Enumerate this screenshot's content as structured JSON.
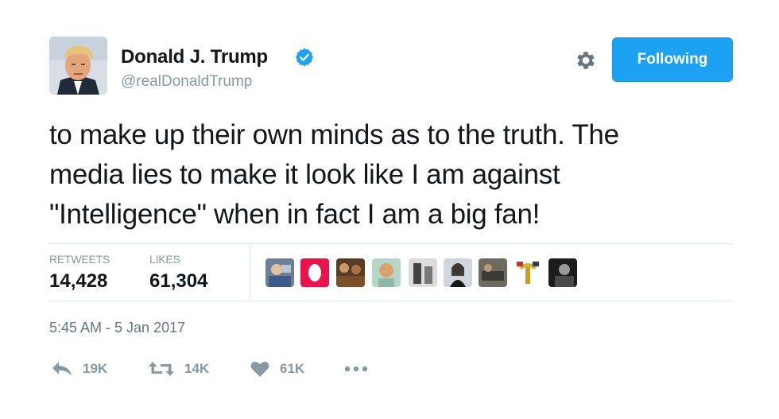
{
  "user": {
    "name": "Donald J. Trump",
    "handle": "@realDonaldTrump",
    "avatar_icon": "profile-photo",
    "verified_icon": "verified-badge-icon"
  },
  "header": {
    "settings_icon": "gear-icon",
    "follow_button_label": "Following"
  },
  "tweet": {
    "lines": [
      "to make up their own minds as to the truth. The",
      "media lies to make it look like I am against",
      "\"Intelligence\" when in fact I am a big fan!"
    ]
  },
  "stats": {
    "retweets_label": "RETWEETS",
    "retweets_value": "14,428",
    "likes_label": "LIKES",
    "likes_value": "61,304",
    "liker_avatars_count": 9
  },
  "timestamp": "5:45 AM - 5 Jan 2017",
  "actions": {
    "reply_count": "19K",
    "retweet_count": "14K",
    "like_count": "61K",
    "more_icon": "more-dots-icon"
  },
  "colors": {
    "accent": "#1da1f2",
    "verified": "#1da1f2",
    "muted": "#8899a6",
    "text": "#14171a"
  }
}
